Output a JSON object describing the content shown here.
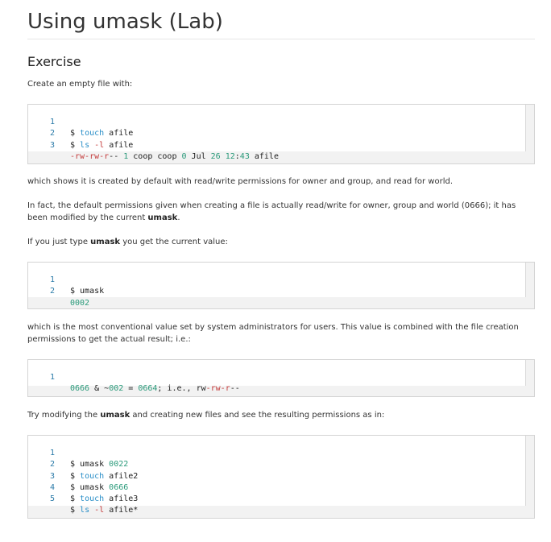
{
  "page": {
    "title": "Using umask (Lab)",
    "section_title": "Exercise"
  },
  "paragraphs": {
    "p1": "Create an empty file with:",
    "p2": "which shows it is created by default with read/write permissions for owner and group, and read for world.",
    "p3_a": "In fact, the default permissions given when creating a file is actually read/write for owner, group and world (0666); it has been modified by the current ",
    "p3_b": "umask",
    "p3_c": ".",
    "p4_a": "If you just type ",
    "p4_b": "umask",
    "p4_c": " you get the current value:",
    "p5": "which is the most conventional value set by system administrators for users. This value is combined with the file creation permissions to get the actual result; i.e.:",
    "p6_a": "Try modifying the ",
    "p6_b": "umask",
    "p6_c": " and creating new files and see the resulting permissions as in:"
  },
  "code_blocks": {
    "b1": {
      "lines": [
        {
          "n": "1",
          "parts": [
            "$ ",
            "touch",
            " afile"
          ]
        },
        {
          "n": "2",
          "parts": [
            "$ ",
            "ls",
            " ",
            "-l",
            " afile"
          ]
        },
        {
          "n": "3",
          "parts": [
            "-rw-rw-r",
            "-- ",
            "1",
            " coop coop ",
            "0",
            " Jul ",
            "26",
            " ",
            "12",
            ":",
            "43",
            " afile"
          ]
        }
      ]
    },
    "b2": {
      "lines": [
        {
          "n": "1",
          "parts": [
            "$ umask"
          ]
        },
        {
          "n": "2",
          "parts": [
            "0002"
          ]
        }
      ]
    },
    "b3": {
      "lines": [
        {
          "n": "1",
          "parts": [
            "0666",
            " & ~",
            "002",
            " = ",
            "0664",
            "; i.e., rw",
            "-rw-r",
            "--"
          ]
        }
      ]
    },
    "b4": {
      "lines": [
        {
          "n": "1",
          "parts": [
            "$ umask ",
            "0022"
          ]
        },
        {
          "n": "2",
          "parts": [
            "$ ",
            "touch",
            " afile2"
          ]
        },
        {
          "n": "3",
          "parts": [
            "$ umask ",
            "0666"
          ]
        },
        {
          "n": "4",
          "parts": [
            "$ ",
            "touch",
            " afile3"
          ]
        },
        {
          "n": "5",
          "parts": [
            "$ ",
            "ls",
            " ",
            "-l",
            " afile*"
          ]
        }
      ]
    }
  },
  "colors": {
    "command": "#2a8fc8",
    "option": "#c43c3c",
    "number": "#2a9a7a",
    "line_number": "#2a7aa8"
  }
}
